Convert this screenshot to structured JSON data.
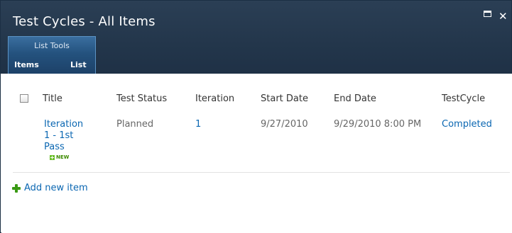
{
  "window": {
    "title": "Test Cycles - All Items",
    "controls": {
      "maximize": "maximize-icon",
      "close_glyph": "✕"
    }
  },
  "ribbon": {
    "group_label": "List Tools",
    "tabs": [
      "Items",
      "List"
    ]
  },
  "list": {
    "columns": [
      "Title",
      "Test Status",
      "Iteration",
      "Start Date",
      "End Date",
      "TestCycle"
    ],
    "rows": [
      {
        "title_lines": [
          "Iteration",
          "1 - 1st",
          "Pass"
        ],
        "new_badge": "NEW",
        "test_status": "Planned",
        "iteration": "1",
        "start_date": "9/27/2010",
        "end_date": "9/29/2010 8:00 PM",
        "test_cycle": "Completed"
      }
    ],
    "add_new_label": "Add new item"
  },
  "colors": {
    "titlebar": "#23364b",
    "ribbon_group": "#24527e",
    "link": "#0b67b2",
    "add_icon": "#3a9a14"
  }
}
